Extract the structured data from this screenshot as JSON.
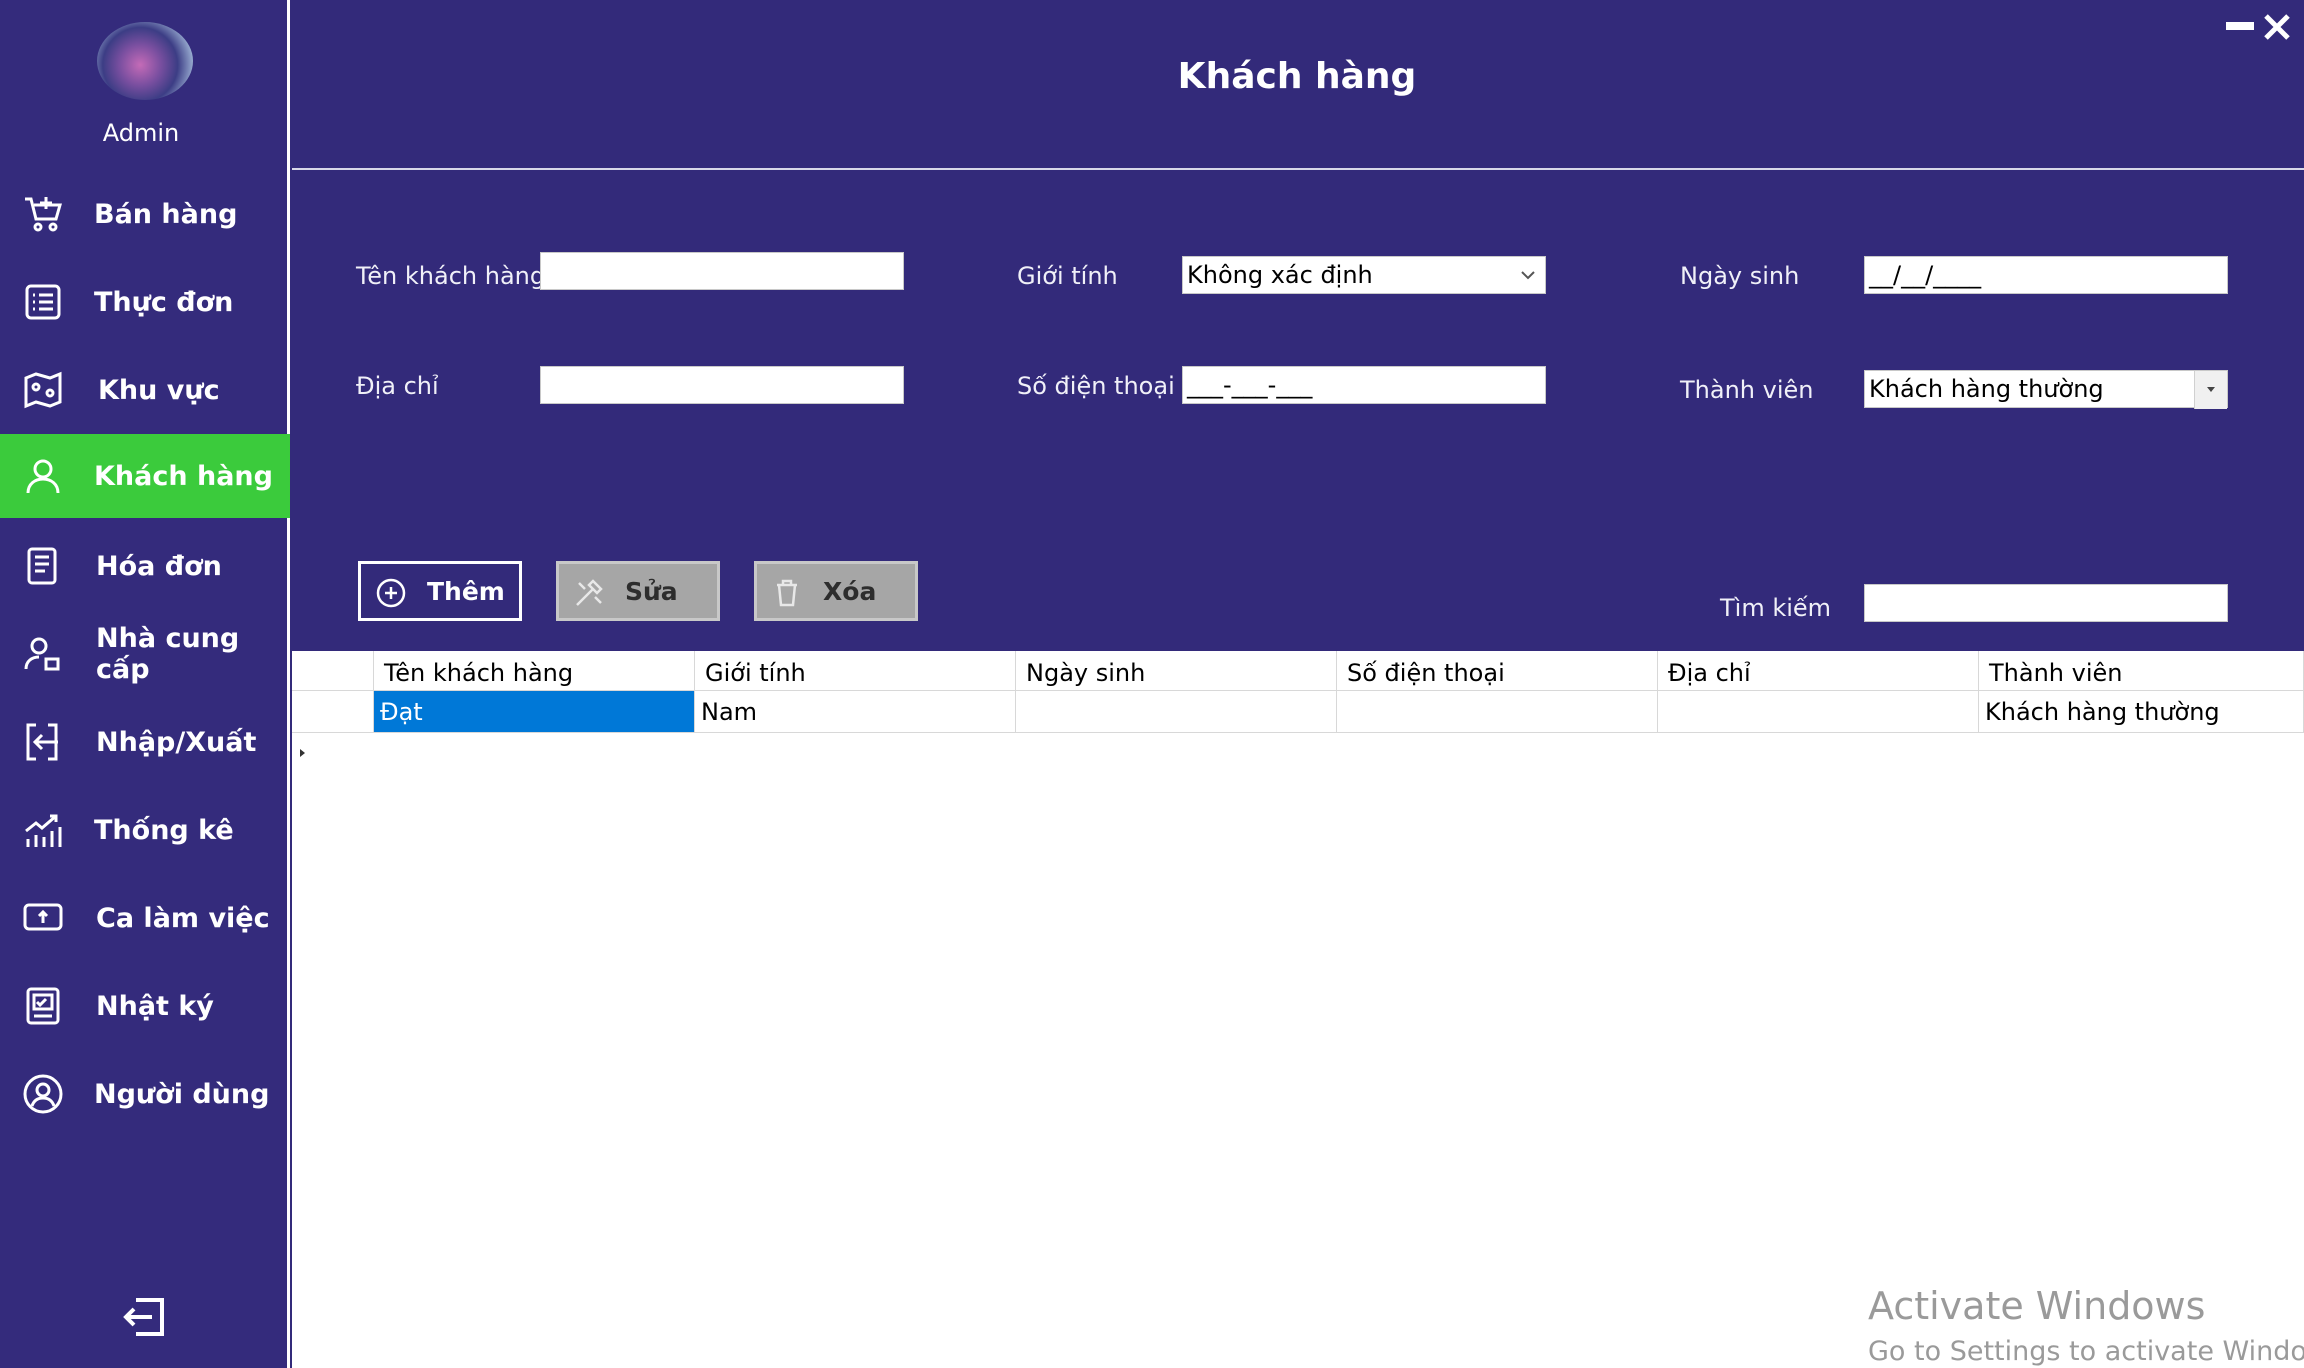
{
  "sidebar": {
    "user": "Admin",
    "items": [
      {
        "label": "Bán hàng",
        "icon": "cart-add-icon"
      },
      {
        "label": "Thực đơn",
        "icon": "menu-list-icon"
      },
      {
        "label": "Khu vực",
        "icon": "map-icon"
      },
      {
        "label": "Khách hàng",
        "icon": "person-icon",
        "active": true
      },
      {
        "label": "Hóa đơn",
        "icon": "receipt-icon"
      },
      {
        "label": "Nhà cung cấp",
        "icon": "supplier-icon"
      },
      {
        "label": "Nhập/Xuất",
        "icon": "import-export-icon"
      },
      {
        "label": "Thống kê",
        "icon": "bar-chart-icon"
      },
      {
        "label": "Ca làm việc",
        "icon": "laptop-icon"
      },
      {
        "label": "Nhật ký",
        "icon": "journal-icon"
      },
      {
        "label": "Người dùng",
        "icon": "user-circle-icon"
      }
    ],
    "logout_icon": "logout-icon"
  },
  "header": {
    "title": "Khách hàng"
  },
  "colors": {
    "background": "#332a7a",
    "active": "#3bcb3c",
    "selected_cell": "#0078d7"
  },
  "form": {
    "name_label": "Tên khách hàng",
    "name_value": "",
    "address_label": "Địa chỉ",
    "address_value": "",
    "gender_label": "Giới tính",
    "gender_value": "Không xác định",
    "phone_label": "Số điện thoại",
    "phone_value": "___-___-___",
    "birth_label": "Ngày sinh",
    "birth_value": "__/__/____",
    "member_label": "Thành viên",
    "member_value": "Khách hàng thường",
    "search_label": "Tìm kiếm",
    "search_value": ""
  },
  "buttons": {
    "add": "Thêm",
    "edit": "Sửa",
    "delete": "Xóa"
  },
  "table": {
    "columns": [
      "Tên khách hàng",
      "Giới tính",
      "Ngày sinh",
      "Số điện thoại",
      "Địa chỉ",
      "Thành viên"
    ],
    "rows": [
      [
        "Đạt",
        "Nam",
        "",
        "",
        "",
        "Khách hàng thường"
      ]
    ]
  },
  "watermark": {
    "title": "Activate Windows",
    "subtitle": "Go to Settings to activate Windows."
  }
}
